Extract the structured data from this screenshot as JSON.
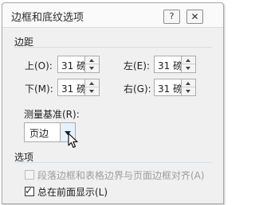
{
  "dialog": {
    "title": "边框和底纹选项",
    "help_label": "?",
    "close_label": "✕"
  },
  "margins": {
    "section_title": "边距",
    "top_label": "上(O):",
    "top_value": "31 磅",
    "left_label": "左(E):",
    "left_value": "31 磅",
    "bottom_label": "下(M):",
    "bottom_value": "31 磅",
    "right_label": "右(G):",
    "right_value": "31 磅"
  },
  "measure": {
    "label": "测量基准(R):",
    "selected": "页边"
  },
  "options": {
    "section_title": "选项",
    "align_label": "段落边框和表格边界与页面边框对齐(A)",
    "align_checked": false,
    "align_disabled": true,
    "front_label": "总在前面显示(L)",
    "front_checked": true
  },
  "colors": {
    "window_bg": "#f0f0f0",
    "titlebar_bg": "#fafafa",
    "section_line": "#d5dfe5",
    "disabled_text": "#9d9d9d",
    "combo_button_hover": "#e5f1fb"
  },
  "icons": {
    "spin_up": "triangle-up",
    "spin_down": "triangle-down",
    "dropdown": "triangle-down",
    "cursor": "mouse-pointer",
    "checkmark": "check"
  }
}
